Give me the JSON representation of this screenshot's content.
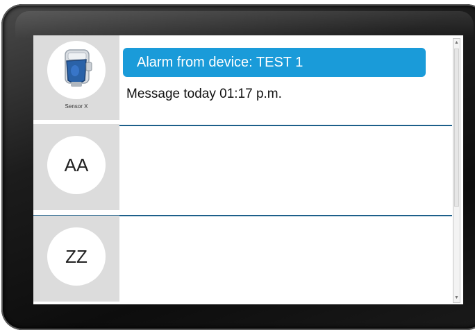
{
  "alerts": [
    {
      "avatar_type": "device-image",
      "avatar_icon": "sensor-device-icon",
      "avatar_caption": "Sensor X",
      "alarm_title": "Alarm from device: TEST 1",
      "message": "Message today 01:17 p.m."
    },
    {
      "avatar_type": "initials",
      "avatar_text": "AA"
    },
    {
      "avatar_type": "initials",
      "avatar_text": "ZZ"
    }
  ],
  "colors": {
    "accent": "#1a9bd9",
    "divider": "#1d5f8a",
    "avatar_panel": "#dcdcdc",
    "device_frame": "#1c1c1c"
  }
}
